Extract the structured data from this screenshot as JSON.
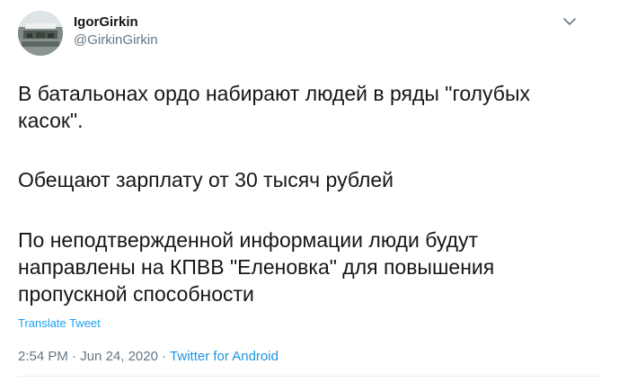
{
  "tweet": {
    "author": {
      "display_name": "IgorGirkin",
      "screen_name": "@GirkinGirkin"
    },
    "menu_icon": "chevron-down-icon",
    "paragraphs": [
      {
        "lines": [
          "В батальонах ордо набирают людей в ряды \"голубых",
          "касок\"."
        ]
      },
      {
        "lines": [
          "Обещают зарплату от 30 тысяч рублей"
        ]
      },
      {
        "lines": [
          "По неподтвержденной информации люди будут",
          "направлены на КПВВ \"Еленовка\" для повышения",
          "пропускной способности"
        ]
      }
    ],
    "translate_label": "Translate Tweet",
    "time": "2:54 PM",
    "separator": " · ",
    "date": "Jun 24, 2020",
    "source": "Twitter for Android"
  },
  "colors": {
    "text": "#14171a",
    "secondary": "#657786",
    "link": "#1da1f2",
    "source_link": "#1b95e0",
    "divider": "#e6ecf0"
  }
}
